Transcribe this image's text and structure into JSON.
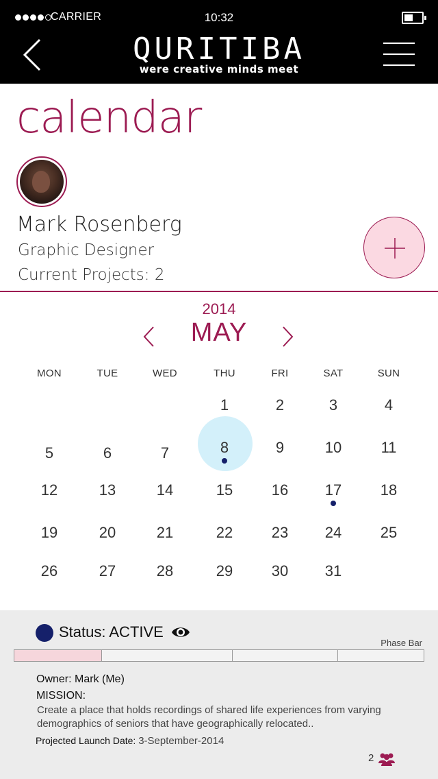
{
  "status_bar": {
    "carrier": "CARRIER",
    "time": "10:32",
    "signal_icon": "signal-dots-icon",
    "battery_icon": "battery-icon"
  },
  "header": {
    "logo_title": "QURITIBA",
    "logo_tagline": "were creative minds meet",
    "back_icon": "chevron-left-icon",
    "menu_icon": "hamburger-menu-icon"
  },
  "page": {
    "title": "calendar"
  },
  "profile": {
    "name": "Mark Rosenberg",
    "role": "Graphic Designer",
    "projects": "Current Projects: 2",
    "add_icon": "plus-icon"
  },
  "calendar": {
    "year": "2014",
    "month": "MAY",
    "weekdays": [
      "MON",
      "TUE",
      "WED",
      "THU",
      "FRI",
      "SAT",
      "SUN"
    ],
    "days": [
      "1",
      "2",
      "3",
      "4",
      "5",
      "6",
      "7",
      "8",
      "9",
      "10",
      "11",
      "12",
      "13",
      "14",
      "15",
      "16",
      "17",
      "18",
      "19",
      "20",
      "21",
      "22",
      "23",
      "24",
      "25",
      "26",
      "27",
      "28",
      "29",
      "30",
      "31"
    ],
    "selected_day": "8",
    "event_days": [
      "8",
      "17"
    ]
  },
  "project": {
    "status": "Status: ACTIVE",
    "status_color": "#15206a",
    "phase_bar_label": "Phase Bar",
    "phase_count": 4,
    "active_phase": 1,
    "owner": "Owner: Mark (Me)",
    "mission_label": "MISSION:",
    "mission_text": "Create a place that holds recordings of shared life experiences from varying demographics of seniors that have geographically relocated..",
    "launch_label": "Projected Launch Date:",
    "launch_date": "3-September-2014",
    "members_count": "2",
    "members_icon": "users-group-icon"
  },
  "colors": {
    "accent": "#9c1b52",
    "highlight": "#d3f0fa",
    "add_button_fill": "#fbd9e2",
    "event_dot": "#15206a",
    "panel_bg": "#ececec"
  }
}
